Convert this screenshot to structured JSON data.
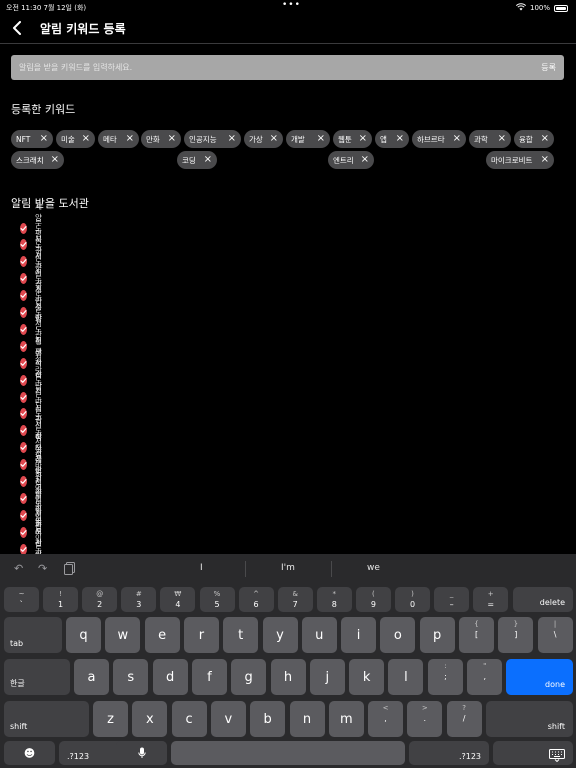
{
  "status_bar": {
    "time": "오전 11:30",
    "date": "7월 12일 (화)",
    "battery": "100%"
  },
  "header": {
    "title": "알림 키워드 등록"
  },
  "search": {
    "placeholder": "알림을 받을 키워드를 입력하세요.",
    "submit_label": "등록"
  },
  "keywords_section": {
    "title": "등록한 키워드",
    "chips": [
      "NFT",
      "미술",
      "메타",
      "만화",
      "인공지능",
      "가상",
      "개발",
      "웹툰",
      "앱",
      "하브르타",
      "과학",
      "융합",
      "스크래치",
      "코딩",
      "엔트리",
      "마이크로비트"
    ]
  },
  "libraries_section": {
    "title": "알림 받을 도서관",
    "items": [
      "계양도서관",
      "부평도서관",
      "북구도서관",
      "서구도서관",
      "연수도서관",
      "주안도서관",
      "중앙도서관",
      "화도진도서관",
      "평생학습관",
      "청라도서관",
      "석남도서관",
      "검단도서관",
      "심곡도서관",
      "신석도서관",
      "학나래도서관",
      "독정골 어린이도서관",
      "석바위 어린이도서관",
      "관교 어린이도서관",
      "송의 어린이도서관",
      "숙골 어린이도서관"
    ]
  },
  "keyboard": {
    "suggestions": [
      "I",
      "I'm",
      "we"
    ],
    "row1": [
      {
        "top": "~",
        "bot": "`"
      },
      {
        "top": "!",
        "bot": "1"
      },
      {
        "top": "@",
        "bot": "2"
      },
      {
        "top": "#",
        "bot": "3"
      },
      {
        "top": "₩",
        "bot": "4"
      },
      {
        "top": "%",
        "bot": "5"
      },
      {
        "top": "^",
        "bot": "6"
      },
      {
        "top": "&",
        "bot": "7"
      },
      {
        "top": "*",
        "bot": "8"
      },
      {
        "top": "(",
        "bot": "9"
      },
      {
        "top": ")",
        "bot": "0"
      },
      {
        "top": "_",
        "bot": "–"
      },
      {
        "top": "+",
        "bot": "="
      }
    ],
    "row2": [
      "q",
      "w",
      "e",
      "r",
      "t",
      "y",
      "u",
      "i",
      "o",
      "p"
    ],
    "row2_punct": [
      {
        "top": "{",
        "bot": "["
      },
      {
        "top": "}",
        "bot": "]"
      },
      {
        "top": "|",
        "bot": "\\"
      }
    ],
    "row3": [
      "a",
      "s",
      "d",
      "f",
      "g",
      "h",
      "j",
      "k",
      "l"
    ],
    "row3_punct": [
      {
        "top": ":",
        "bot": ";"
      },
      {
        "top": "\"",
        "bot": ","
      }
    ],
    "row4": [
      "z",
      "x",
      "c",
      "v",
      "b",
      "n",
      "m"
    ],
    "row4_punct": [
      {
        "top": "<",
        "bot": ","
      },
      {
        "top": ">",
        "bot": "."
      },
      {
        "top": "?",
        "bot": "/"
      }
    ],
    "delete_label": "delete",
    "tab_label": "tab",
    "lang_label": "한글",
    "done_label": "done",
    "shift_label": "shift",
    "num_label": ".?123",
    "accent_color": "#0b6ffe"
  }
}
